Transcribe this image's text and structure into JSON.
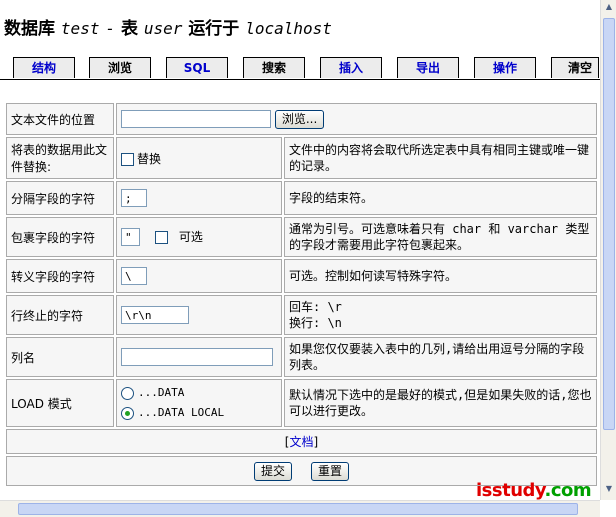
{
  "header": {
    "prefix": "数据库",
    "db": "test",
    "dash": "-",
    "table_word": "表",
    "table": "user",
    "runs_on": "运行于",
    "host": "localhost"
  },
  "tabs": [
    {
      "label": "结构"
    },
    {
      "label": "浏览"
    },
    {
      "label": "SQL"
    },
    {
      "label": "搜索"
    },
    {
      "label": "插入"
    },
    {
      "label": "导出"
    },
    {
      "label": "操作"
    },
    {
      "label": "清空"
    }
  ],
  "form": {
    "file_location": {
      "label": "文本文件的位置",
      "value": "",
      "browse_label": "浏览..."
    },
    "replace": {
      "label": "将表的数据用此文件替换:",
      "checkbox_label": "替换",
      "desc": "文件中的内容将会取代所选定表中具有相同主键或唯一键的记录。"
    },
    "field_sep": {
      "label": "分隔字段的字符",
      "value": ";",
      "desc": "字段的结束符。"
    },
    "enclosed": {
      "label": "包裹字段的字符",
      "value": "\"",
      "optional_label": "可选",
      "desc": "通常为引号。可选意味着只有 char 和 varchar 类型的字段才需要用此字符包裹起来。"
    },
    "escaped": {
      "label": "转义字段的字符",
      "value": "\\",
      "desc": "可选。控制如何读写特殊字符。"
    },
    "line_term": {
      "label": "行终止的字符",
      "value": "\\r\\n",
      "desc_line1": "回车: \\r",
      "desc_line2": "换行: \\n"
    },
    "columns": {
      "label": "列名",
      "value": "",
      "desc": "如果您仅仅要装入表中的几列,请给出用逗号分隔的字段列表。"
    },
    "load_mode": {
      "label": "LOAD 模式",
      "option1": "...DATA",
      "option2": "...DATA LOCAL",
      "selected": "...DATA LOCAL",
      "desc": "默认情况下选中的是最好的模式,但是如果失败的话,您也可以进行更改。"
    },
    "doc_link": "文档",
    "doc_open": "[",
    "doc_close": "]"
  },
  "buttons": {
    "submit": "提交",
    "reset": "重置"
  },
  "watermark": {
    "part1": "isstudy",
    "part2": ".com"
  }
}
